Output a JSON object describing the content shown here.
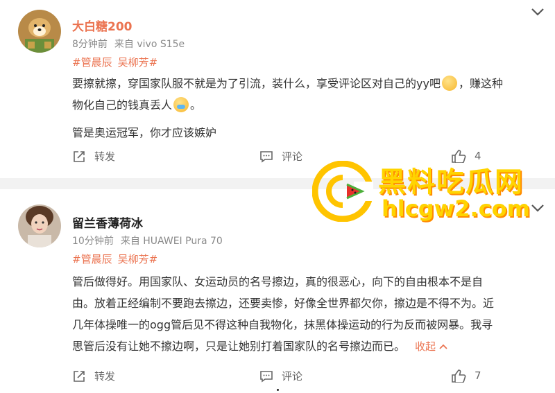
{
  "posts": [
    {
      "username": "大白糖200",
      "time": "8分钟前",
      "source": "来自 vivo S15e",
      "tags": [
        "#管晨辰",
        "吴柳芳#"
      ],
      "body_line1_a": "要擦就擦，穿国家队服不就是为了引流，装什么，享受评论区对自己的yy吧",
      "body_line1_b": "，赚这种",
      "body_line2": "物化自己的钱真丢人",
      "body_line2_end": "。",
      "body_line3": "管是奥运冠军，你才应该嫉妒",
      "repost_label": "转发",
      "comment_label": "评论",
      "like_count": "4"
    },
    {
      "username": "留兰香薄荷冰",
      "time": "10分钟前",
      "source": "来自 HUAWEI Pura 70",
      "tags": [
        "#管晨辰",
        "吴柳芳#"
      ],
      "body_line1": "管后做得好。用国家队、女运动员的名号擦边，真的很恶心，向下的自由根本不是自",
      "body_line2": "由。放着正经编制不要跑去擦边，还要卖惨，好像全世界都欠你，擦边是不得不为。近",
      "body_line3": "几年体操唯一的ogg管后见不得这种自我物化，抹黑体操运动的行为反而被网暴。我寻",
      "body_line4": "思管后没有让她不擦边啊，只是让她别打着国家队的名号擦边而已。",
      "collapse_label": "收起",
      "repost_label": "转发",
      "comment_label": "评论",
      "like_count": "7"
    }
  ],
  "watermark": {
    "title": "黑料吃瓜网",
    "url": "hlcgw2.com"
  },
  "colors": {
    "tag": "#eb7350",
    "meta": "#8a8a8a",
    "separator": "#f2f2f2",
    "watermark": "#ffd400"
  }
}
